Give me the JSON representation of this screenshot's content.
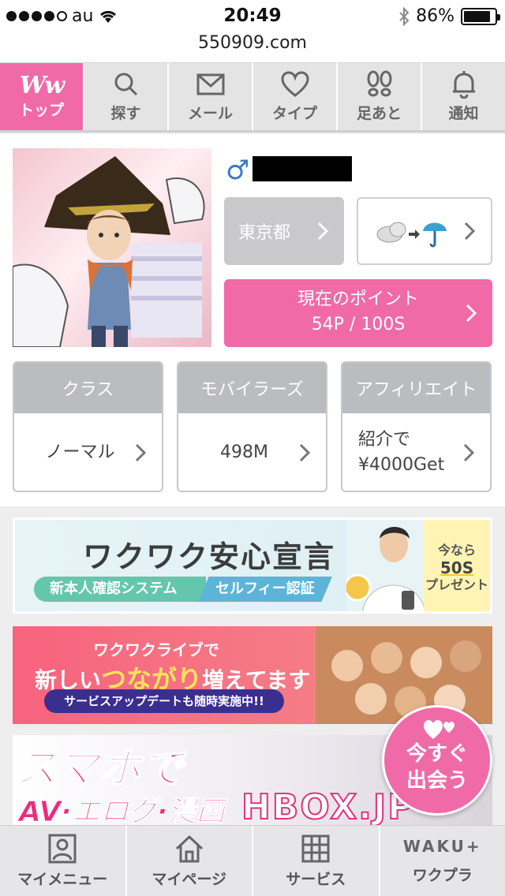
{
  "status_bar": {
    "carrier": "au",
    "time": "20:49",
    "battery": "86%",
    "battery_level": 0.86
  },
  "url": "550909.com",
  "top_nav": [
    {
      "label": "トップ",
      "icon": "ww-logo-icon",
      "logo_text": "Ww",
      "active": true
    },
    {
      "label": "探す",
      "icon": "search-icon"
    },
    {
      "label": "メール",
      "icon": "mail-icon"
    },
    {
      "label": "タイプ",
      "icon": "heart-icon"
    },
    {
      "label": "足あと",
      "icon": "footprints-icon"
    },
    {
      "label": "通知",
      "icon": "bell-icon"
    }
  ],
  "profile": {
    "gender_symbol": "♂",
    "prefecture": "東京都",
    "weather": "☁️▸☂",
    "points_title": "現在のポイント",
    "points_value": "54P / 100S"
  },
  "cards": [
    {
      "title": "クラス",
      "value": "ノーマル"
    },
    {
      "title": "モバイラーズ",
      "value": "498M"
    },
    {
      "title": "アフィリエイト",
      "value_line1": "紹介で",
      "value_line2": "¥4000Get"
    }
  ],
  "banner_safety": {
    "title": "ワクワク安心宣言",
    "tag1": "新本人確認システム",
    "tag2": "セルフィー認証",
    "promo_line1": "今なら",
    "promo_line2": "50S",
    "promo_line3": "プレゼント"
  },
  "banner_live": {
    "line1": "ワクワクライブで",
    "line2_a": "新しい",
    "line2_accent": "つながり",
    "line2_b": "増えてます",
    "line3": "サービスアップデートも随時実施中!!"
  },
  "banner_hbox": {
    "line1": "スマホで",
    "line2": "AV·エログ·漫画",
    "brand": "HBOX.JP"
  },
  "meet_button": {
    "line1": "今すぐ",
    "line2": "出会う"
  },
  "bottom_tabs": [
    {
      "label": "マイメニュー",
      "icon": "person-card-icon"
    },
    {
      "label": "マイページ",
      "icon": "home-icon"
    },
    {
      "label": "サービス",
      "icon": "grid-icon"
    },
    {
      "label": "ワクプラ",
      "icon": "waku-plus-logo",
      "logo_text": "WAKU+"
    }
  ],
  "colors": {
    "accent_pink": "#f06aa8",
    "nav_bg": "#e5e4e5",
    "gray_button": "#c9c9cc"
  }
}
